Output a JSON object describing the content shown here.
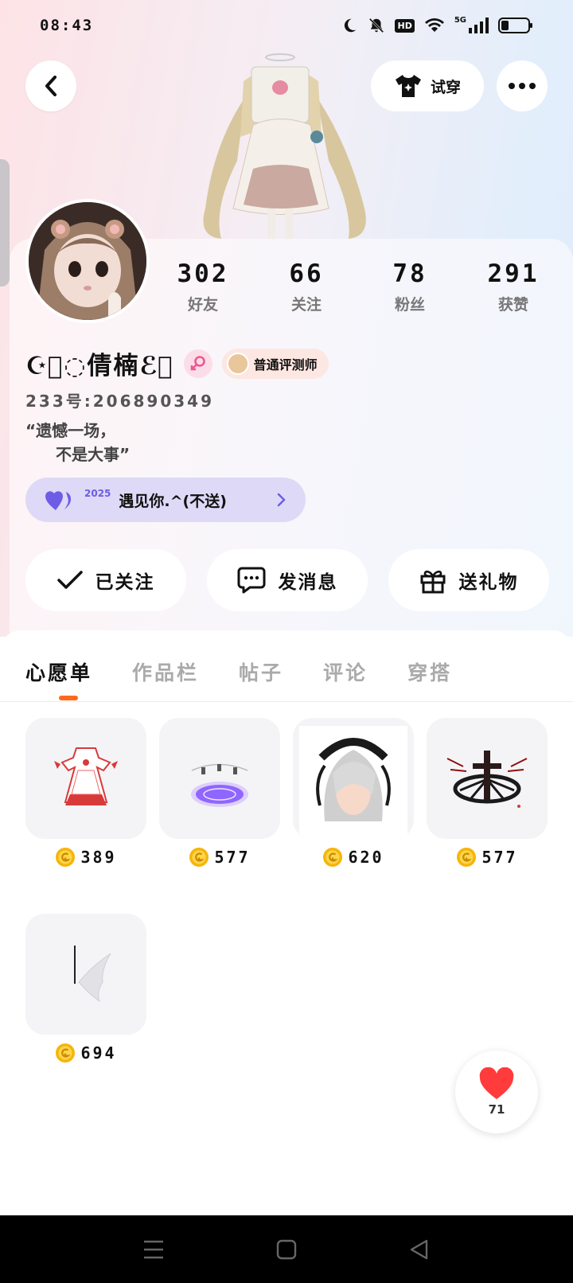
{
  "status_bar": {
    "time": "08:43",
    "hd": "HD",
    "network": "5G",
    "icons": [
      "moon-icon",
      "mute-icon",
      "hd-icon",
      "wifi-icon",
      "signal-icon",
      "battery-icon"
    ]
  },
  "header": {
    "back_icon": "chevron-left-icon",
    "tryon_label": "试穿",
    "more_icon": "more-icon"
  },
  "stats": [
    {
      "value": "302",
      "label": "好友"
    },
    {
      "value": "66",
      "label": "关注"
    },
    {
      "value": "78",
      "label": "粉丝"
    },
    {
      "value": "291",
      "label": "获赞"
    }
  ],
  "profile": {
    "nickname": "☪⃝◌倩楠ℰ⃝",
    "gender": "female",
    "title_badge": "普通评测师",
    "user_id": "233号:206890349",
    "bio_line1": "“遗憾一场，",
    "bio_line2": "不是大事”",
    "event_year": "2025",
    "event_text": "遇见你.^(不送)"
  },
  "actions": [
    {
      "label": "已关注",
      "icon": "check-icon"
    },
    {
      "label": "发消息",
      "icon": "message-icon"
    },
    {
      "label": "送礼物",
      "icon": "gift-icon"
    }
  ],
  "tabs": [
    "心愿单",
    "作品栏",
    "帖子",
    "评论",
    "穿搭"
  ],
  "active_tab": "心愿单",
  "wishlist": [
    {
      "price": "389",
      "item": "maid-dress"
    },
    {
      "price": "577",
      "item": "purple-halo"
    },
    {
      "price": "620",
      "item": "silver-hair"
    },
    {
      "price": "577",
      "item": "dark-cross"
    },
    {
      "price": "694",
      "item": "white-wing"
    }
  ],
  "likes": {
    "count": "71"
  },
  "colors": {
    "accent": "#ff6a1a",
    "event_pill": "#ddd9f6",
    "heart": "#ff3b3b",
    "coin": "#f5b50a"
  }
}
